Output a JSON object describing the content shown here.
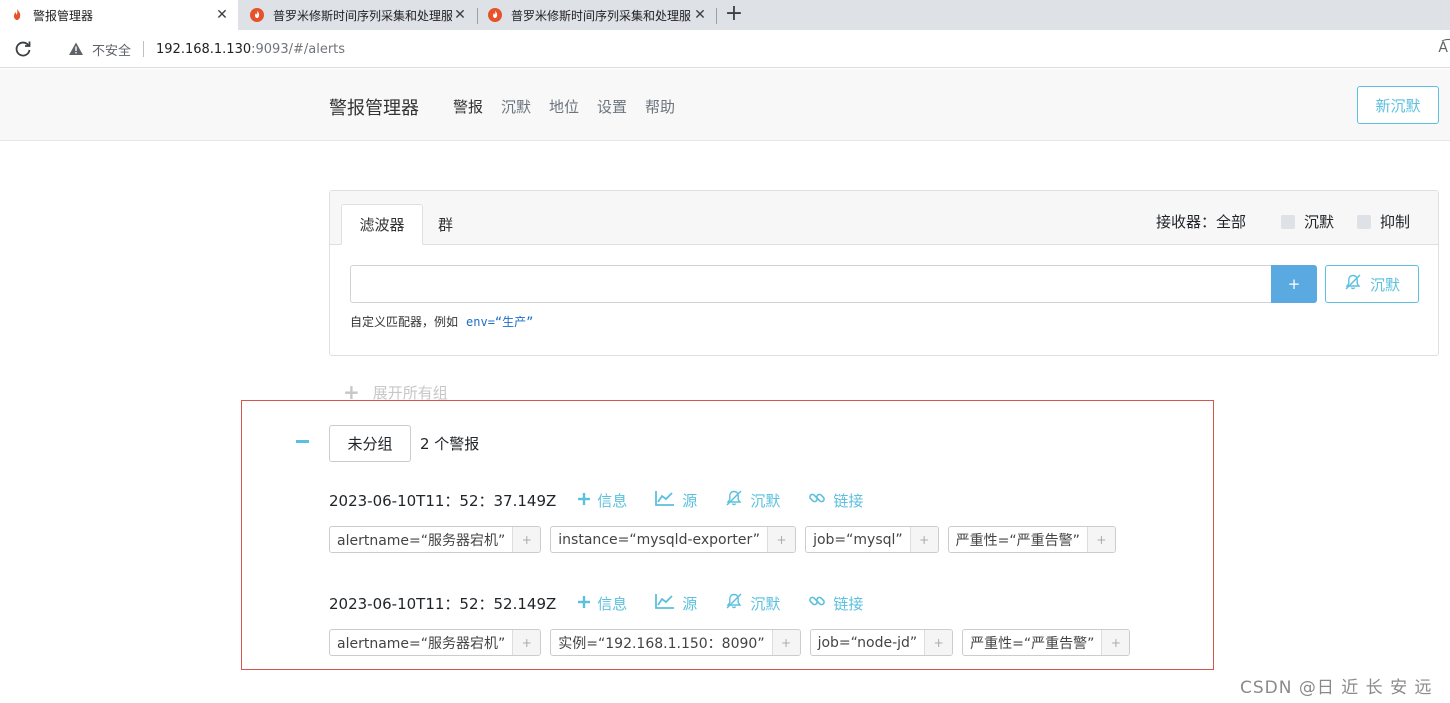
{
  "browser": {
    "tabs": [
      {
        "title": "警报管理器",
        "active": true
      },
      {
        "title": "普罗米修斯时间序列采集和处理服",
        "active": false
      },
      {
        "title": "普罗米修斯时间序列采集和处理服",
        "active": false
      }
    ],
    "security_label": "不安全",
    "url_host": "192.168.1.130",
    "url_rest": ":9093/#/alerts",
    "reader_icon_text": "A͡"
  },
  "navbar": {
    "brand": "警报管理器",
    "links": [
      "警报",
      "沉默",
      "地位",
      "设置",
      "帮助"
    ],
    "active_link": "警报",
    "new_silence": "新沉默"
  },
  "filter_card": {
    "tab_filter": "滤波器",
    "tab_groups": "群",
    "receiver": "接收器：全部",
    "check_silenced": "沉默",
    "check_inhibited": "抑制",
    "input_value": "",
    "add_button": "+",
    "silence_button": "沉默",
    "hint_text": "自定义匹配器，例如",
    "hint_example": "env=“生产”"
  },
  "expand_all": "展开所有组",
  "group": {
    "name": "未分组",
    "count": "2 个警报"
  },
  "alert_actions": {
    "info": "信息",
    "source": "源",
    "silence": "沉默",
    "link": "链接"
  },
  "alerts": [
    {
      "time": "2023-06-10T11：52：37.149Z",
      "labels": [
        "alertname=“服务器宕机”",
        "instance=“mysqld-exporter”",
        "job=“mysql”",
        "严重性=“严重告警”"
      ]
    },
    {
      "time": "2023-06-10T11：52：52.149Z",
      "labels": [
        "alertname=“服务器宕机”",
        "实例=“192.168.1.150：8090”",
        "job=“node-jd”",
        "严重性=“严重告警”"
      ]
    }
  ],
  "label_add": "+",
  "watermark": "CSDN @日 近 长 安 远",
  "colors": {
    "accent": "#5bc0de",
    "primary_button": "#5aa9e0",
    "highlight_border": "#d9534f"
  }
}
